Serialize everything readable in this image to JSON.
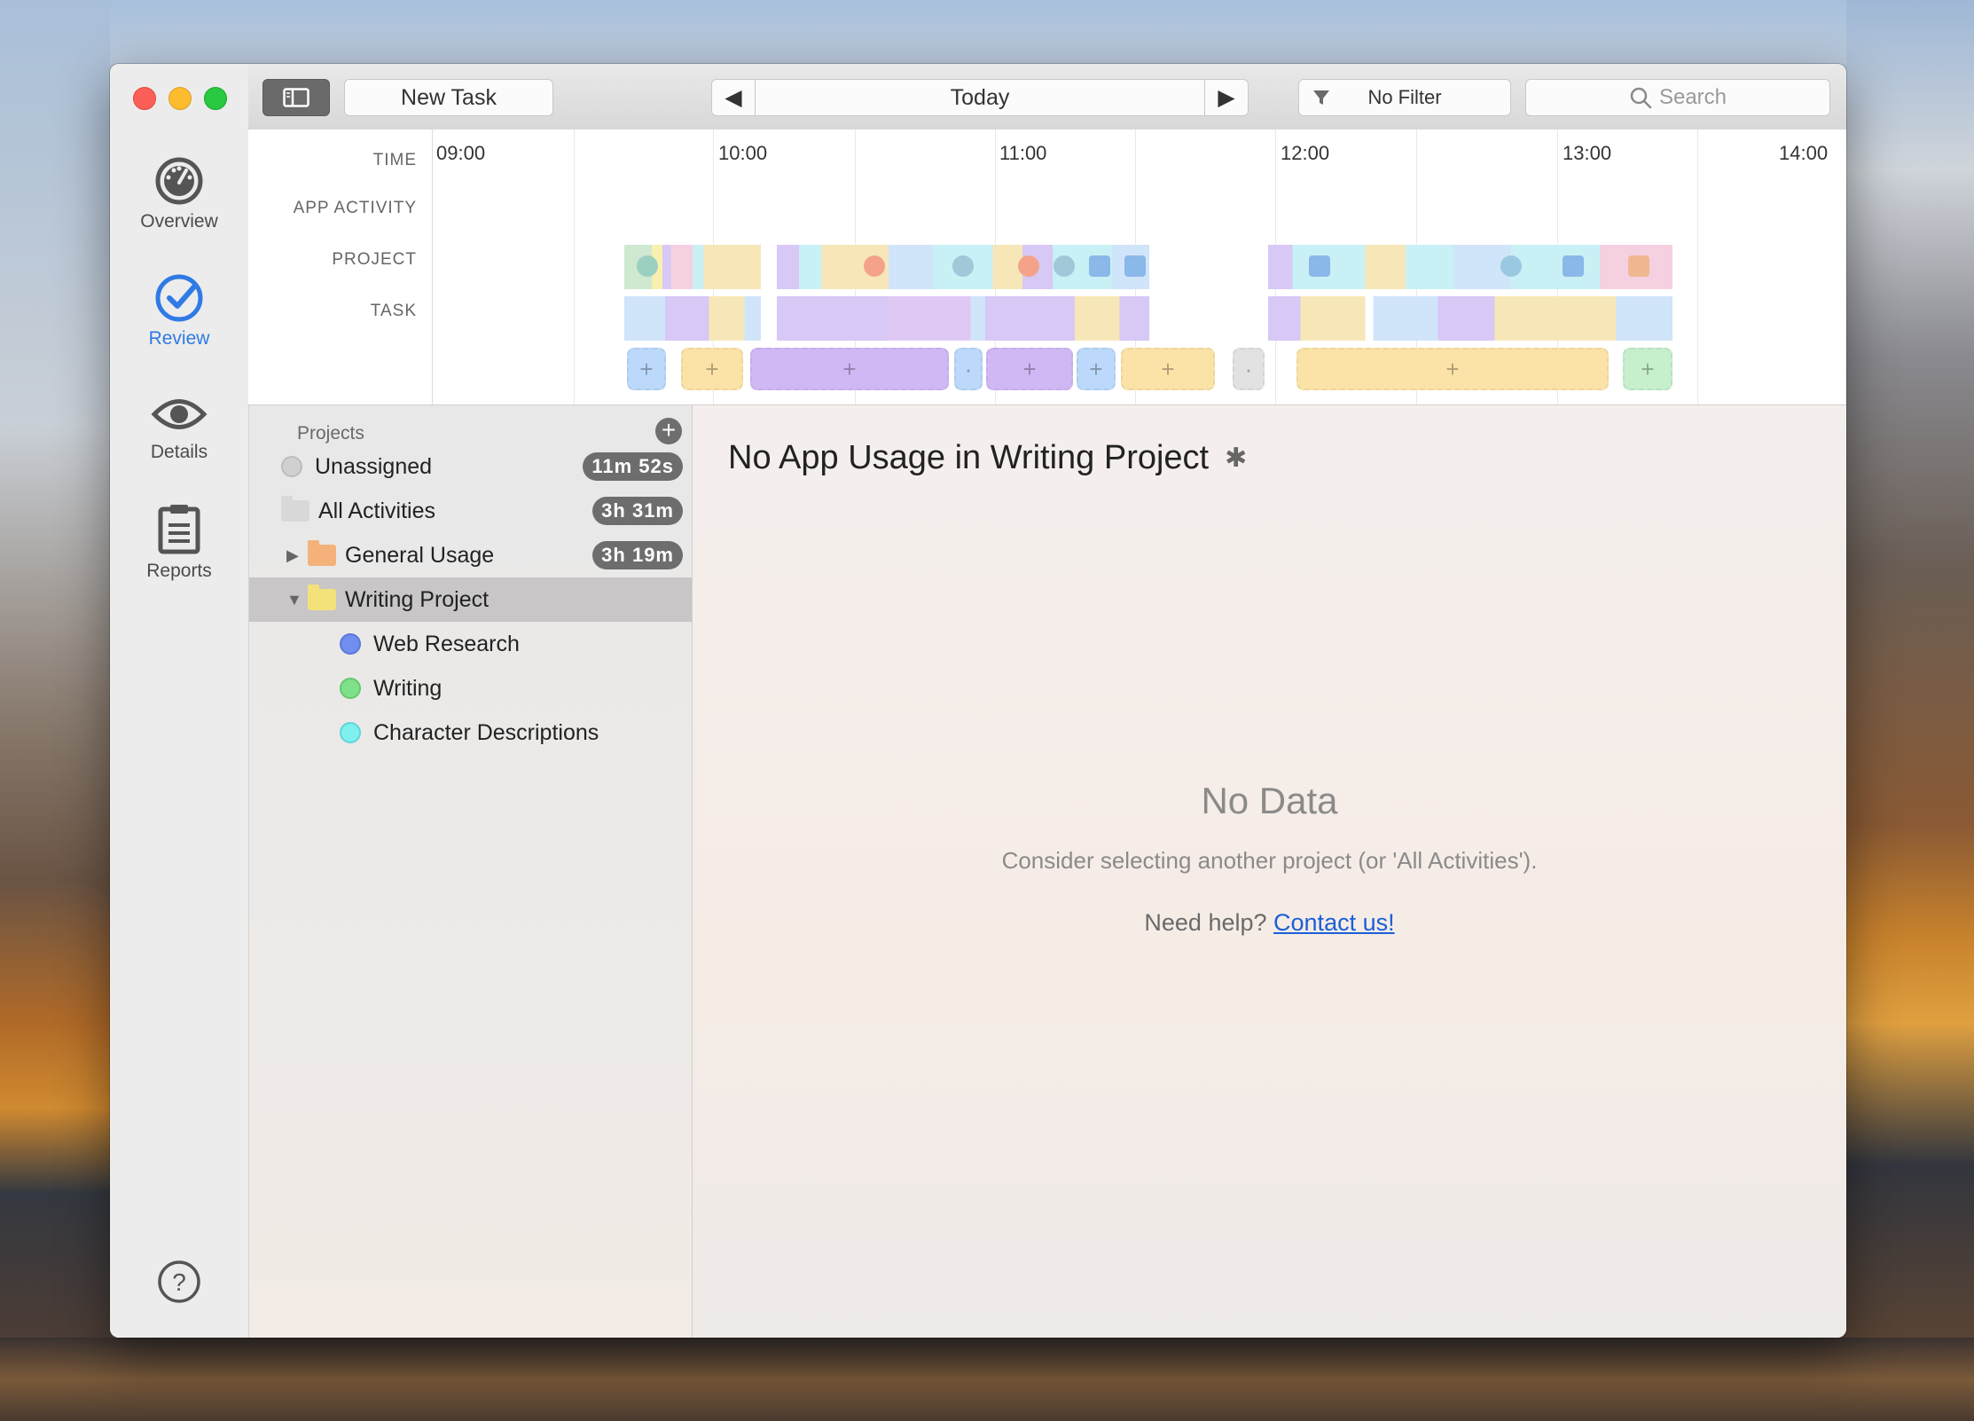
{
  "toolbar": {
    "new_task": "New Task",
    "date_label": "Today",
    "filter_label": "No Filter",
    "search_placeholder": "Search"
  },
  "nav": {
    "items": [
      {
        "label": "Overview",
        "icon": "gauge-icon"
      },
      {
        "label": "Review",
        "icon": "checkmark-circle-icon",
        "active": true
      },
      {
        "label": "Details",
        "icon": "eye-icon"
      },
      {
        "label": "Reports",
        "icon": "clipboard-icon"
      }
    ],
    "help_icon": "help-icon",
    "accent_color": "#2f7ae5"
  },
  "timeline": {
    "row_labels": {
      "time": "TIME",
      "app_activity": "APP ACTIVITY",
      "project": "PROJECT",
      "task": "TASK"
    },
    "ticks": [
      "09:00",
      "10:00",
      "11:00",
      "12:00",
      "13:00",
      "14:00"
    ]
  },
  "projects": {
    "header": "Projects",
    "add_icon": "plus-circle-icon",
    "items": [
      {
        "label": "Unassigned",
        "badge": "11m 52s",
        "color": "#d0d0d0"
      },
      {
        "label": "All Activities",
        "badge": "3h 31m",
        "color": "#d8d8d8"
      },
      {
        "label": "General Usage",
        "badge": "3h 19m",
        "color": "#f4b27a"
      },
      {
        "label": "Writing Project",
        "color": "#f3e27a",
        "selected": true
      },
      {
        "label": "Web Research",
        "color": "#6f8ef0"
      },
      {
        "label": "Writing",
        "color": "#7fe08a"
      },
      {
        "label": "Character Descriptions",
        "color": "#7ff0f0"
      }
    ]
  },
  "main": {
    "title": "No App Usage in Writing Project",
    "settings_icon": "gear-icon",
    "empty_title": "No Data",
    "empty_subtitle": "Consider selecting another project (or 'All Activities').",
    "help_prefix": "Need help?",
    "help_link": "Contact us!"
  }
}
